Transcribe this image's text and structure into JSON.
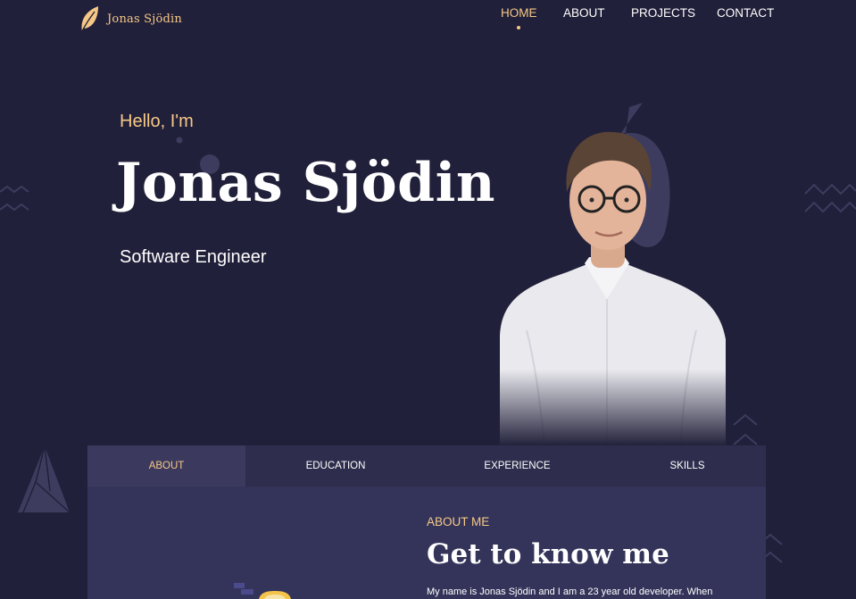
{
  "brand": {
    "name": "Jonas Sjödin",
    "accent": "#f6c886",
    "background": "#21203a"
  },
  "nav": {
    "items": [
      {
        "label": "HOME",
        "active": true
      },
      {
        "label": "ABOUT",
        "active": false
      },
      {
        "label": "PROJECTS",
        "active": false
      },
      {
        "label": "CONTACT",
        "active": false
      }
    ]
  },
  "hero": {
    "greeting": "Hello, I'm",
    "name": "Jonas Sjödin",
    "role": "Software Engineer"
  },
  "tabs": {
    "items": [
      {
        "label": "ABOUT",
        "active": true
      },
      {
        "label": "EDUCATION",
        "active": false
      },
      {
        "label": "EXPERIENCE",
        "active": false
      },
      {
        "label": "SKILLS",
        "active": false
      }
    ]
  },
  "about": {
    "label": "ABOUT ME",
    "title": "Get to know me",
    "text": "My name is Jonas Sjödin and I am a 23 year old developer. When"
  },
  "icons": {
    "logo": "leaf-icon",
    "decorations": [
      "zigzag-icon",
      "triangle-icon",
      "chevron-icon",
      "dot-icon"
    ]
  }
}
